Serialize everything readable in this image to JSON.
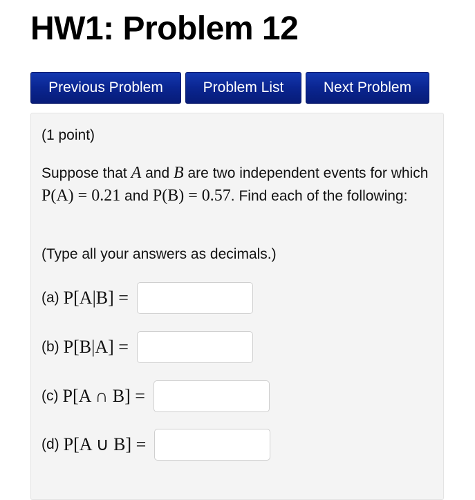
{
  "page": {
    "title": "HW1: Problem 12"
  },
  "nav": {
    "previous_label": "Previous Problem",
    "list_label": "Problem List",
    "next_label": "Next Problem",
    "button_color": "#0a2590"
  },
  "problem": {
    "points": "(1 point)",
    "text_1": "Suppose that ",
    "var_a": "A",
    "text_2": " and ",
    "var_b": "B",
    "text_3": " are two independent events for which ",
    "pa_expr": "P(A) = 0.21",
    "text_4": " and ",
    "pb_expr": "P(B) = 0.57",
    "text_5": ". Find each of the following:",
    "instructions": "(Type all your answers as decimals.)",
    "parts": [
      {
        "label": "(a)",
        "expression": "P[A|B] =",
        "value": ""
      },
      {
        "label": "(b)",
        "expression": "P[B|A] =",
        "value": ""
      },
      {
        "label": "(c)",
        "expression": "P[A ∩ B] =",
        "value": ""
      },
      {
        "label": "(d)",
        "expression": "P[A ∪ B] =",
        "value": ""
      }
    ]
  }
}
